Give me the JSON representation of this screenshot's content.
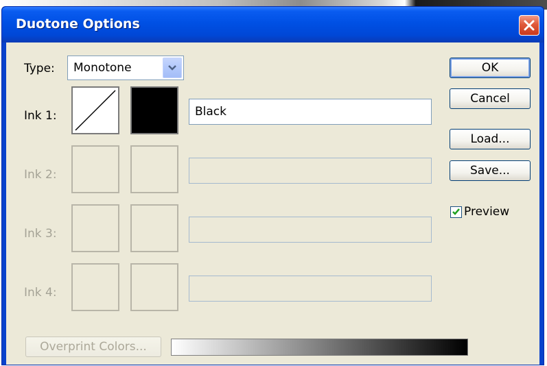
{
  "dialog": {
    "title": "Duotone Options"
  },
  "type_select": {
    "label": "Type:",
    "value": "Monotone"
  },
  "inks": [
    {
      "label": "Ink 1:",
      "name": "Black",
      "enabled": true,
      "color": "#000000"
    },
    {
      "label": "Ink 2:",
      "name": "",
      "enabled": false
    },
    {
      "label": "Ink 3:",
      "name": "",
      "enabled": false
    },
    {
      "label": "Ink 4:",
      "name": "",
      "enabled": false
    }
  ],
  "buttons": {
    "ok": "OK",
    "cancel": "Cancel",
    "load": "Load...",
    "save": "Save...",
    "overprint": "Overprint Colors..."
  },
  "preview": {
    "label": "Preview",
    "checked": true
  },
  "colors": {
    "title_bar": "#0050e4",
    "dialog_bg": "#ece9d8",
    "disabled_text": "#a5a396"
  },
  "icons": {
    "close": "close-x-icon",
    "dropdown": "chevron-down-icon",
    "checkbox": "checkmark-icon",
    "curve": "diagonal-curve-icon"
  }
}
